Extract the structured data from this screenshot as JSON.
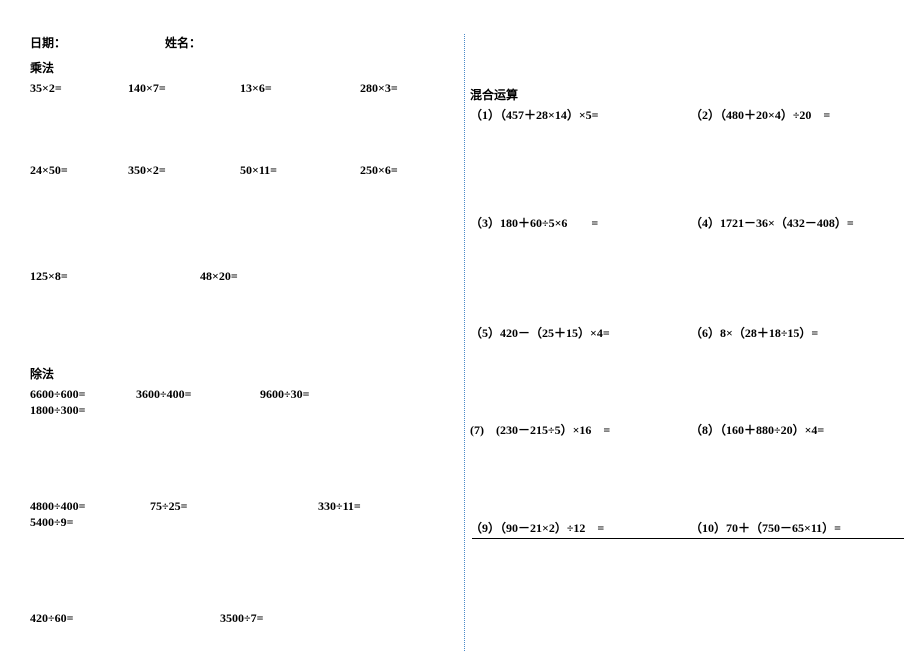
{
  "header": {
    "date_label": "日期：",
    "name_label": "姓名："
  },
  "left": {
    "section1_title": "乘法",
    "row1": {
      "a": "35×2=",
      "b": "140×7=",
      "c": "13×6=",
      "d": "280×3="
    },
    "row2": {
      "a": "24×50=",
      "b": "350×2=",
      "c": "50×11=",
      "d": "250×6="
    },
    "row3": {
      "a": "125×8=",
      "b": "48×20="
    },
    "section2_title": "除法",
    "row4": {
      "a": "6600÷600=",
      "b": "3600÷400=",
      "c": "9600÷30=",
      "d": "1800÷300="
    },
    "row5": {
      "a": "4800÷400=",
      "b": "75÷25=",
      "c": "330÷11=",
      "d": "5400÷9="
    },
    "row6": {
      "a": "420÷60=",
      "b": "3500÷7="
    }
  },
  "right": {
    "section_title": "混合运算",
    "q1": "（1）（457＋28×14）×5=",
    "q2": "（2）（480＋20×4）÷20　=",
    "q3": "（3）180＋60÷5×6　　=",
    "q4": "（4）1721－36×（432－408）=",
    "q5": "（5）420－（25＋15）×4=",
    "q6": "（6）8×（28＋18÷15）=",
    "q7": "(7)　(230－215÷5）×16　=",
    "q8": "（8）（160＋880÷20）×4=",
    "q9": "（9）（90－21×2）÷12　=",
    "q10": "（10）70＋（750－65×11）="
  }
}
